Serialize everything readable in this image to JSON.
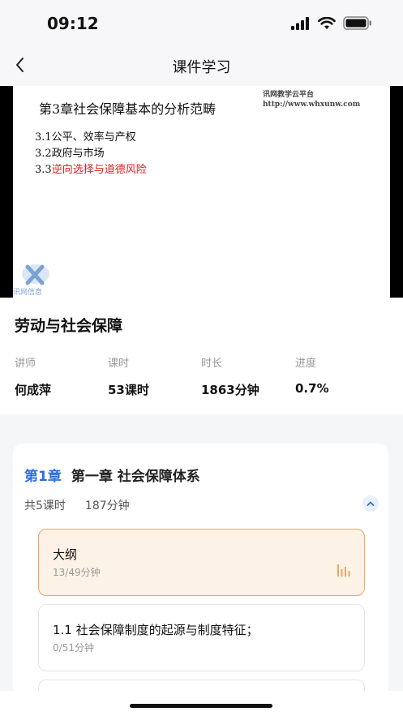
{
  "status": {
    "time": "09:12"
  },
  "nav": {
    "title": "课件学习"
  },
  "slide": {
    "title": "第3章社会保障基本的分析范畴",
    "tag_line1": "讯网教学云平台",
    "tag_line2": "http://www.whxunw.com",
    "items": [
      {
        "text": "3.1公平、效率与产权"
      },
      {
        "text": "3.2政府与市场"
      }
    ],
    "item3_prefix": "3.3",
    "item3_highlight": "逆向选择与道德风险",
    "logo_text": "讯网信息"
  },
  "course": {
    "title": "劳动与社会保障",
    "stats": [
      {
        "label": "讲师",
        "value": "何成萍"
      },
      {
        "label": "课时",
        "value": "53课时"
      },
      {
        "label": "时长",
        "value": "1863分钟"
      },
      {
        "label": "进度",
        "value": "0.7%"
      }
    ]
  },
  "chapter": {
    "number": "第1章",
    "name": "第一章 社会保障体系",
    "lessons_count": "共5课时",
    "duration": "187分钟",
    "lessons": [
      {
        "title": "大纲",
        "time": "13/49分钟"
      },
      {
        "title": "1.1 社会保障制度的起源与制度特征；",
        "time": "0/51分钟"
      }
    ]
  },
  "colors": {
    "accent": "#2e6fdb",
    "active_bg": "#fdf2e6",
    "active_border": "#e8a868",
    "highlight_red": "#e02020"
  }
}
